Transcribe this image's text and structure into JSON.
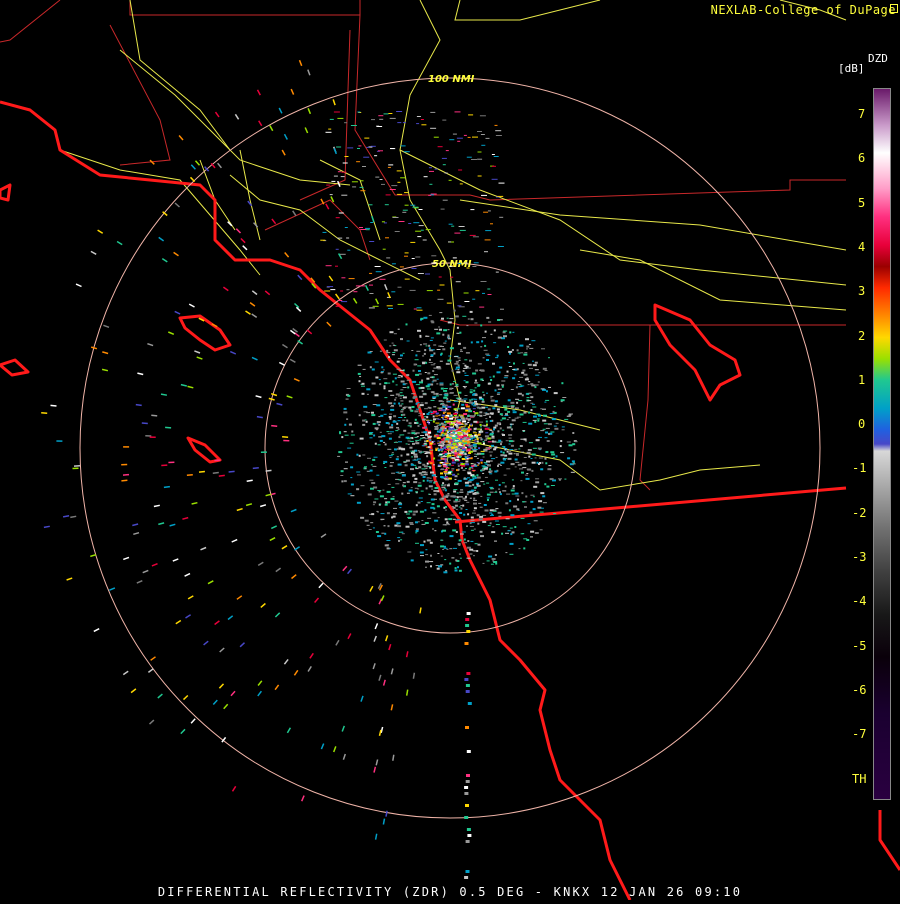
{
  "header": {
    "credit": "NEXLAB-College of DuPage"
  },
  "footer": {
    "caption": "DIFFERENTIAL REFLECTIVITY (ZDR) 0.5 DEG - KNKX 12 JAN 26 09:10"
  },
  "range_rings": [
    {
      "label": "50 NMI",
      "range_nmi": 50
    },
    {
      "label": "100 NMI",
      "range_nmi": 100
    }
  ],
  "legend": {
    "product": "DZD",
    "unit": "[dB]",
    "ticks": [
      "7",
      "6",
      "5",
      "4",
      "3",
      "2",
      "1",
      "0",
      "-1",
      "-2",
      "-3",
      "-4",
      "-5",
      "-6",
      "-7",
      "TH"
    ]
  },
  "colors": {
    "background": "#000000",
    "coastline": "#ff1a1a",
    "boundaries": "#c8282a",
    "highways": "#e8e84a",
    "rings": "#f0b4a8",
    "labels": "#ffff3c"
  },
  "icons": {
    "logo": "nexlab-logo-icon"
  }
}
